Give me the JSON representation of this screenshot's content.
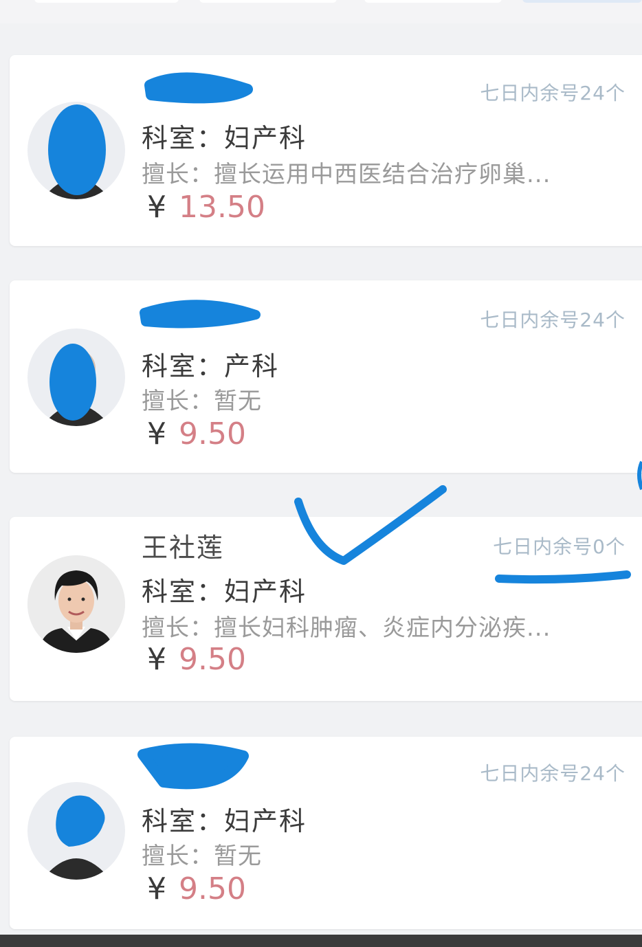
{
  "doctors": [
    {
      "name": "",
      "dept_label": "科室",
      "dept": "妇产科",
      "spec_label": "擅长",
      "spec": "擅长运用中西医结合治疗卵巢...",
      "currency": "¥",
      "price": "13.50",
      "slots": "七日内余号24个"
    },
    {
      "name": "",
      "dept_label": "科室",
      "dept": "产科",
      "spec_label": "擅长",
      "spec": "暂无",
      "currency": "¥",
      "price": "9.50",
      "slots": "七日内余号24个"
    },
    {
      "name": "王社莲",
      "dept_label": "科室",
      "dept": "妇产科",
      "spec_label": "擅长",
      "spec": "擅长妇科肿瘤、炎症内分泌疾...",
      "currency": "¥",
      "price": "9.50",
      "slots": "七日内余号0个"
    },
    {
      "name": "",
      "dept_label": "科室",
      "dept": "妇产科",
      "spec_label": "擅长",
      "spec": "暂无",
      "currency": "¥",
      "price": "9.50",
      "slots": "七日内余号24个"
    }
  ],
  "colors": {
    "price": "#d47f86",
    "slots": "#a9bac8",
    "annotation": "#1684dc"
  }
}
